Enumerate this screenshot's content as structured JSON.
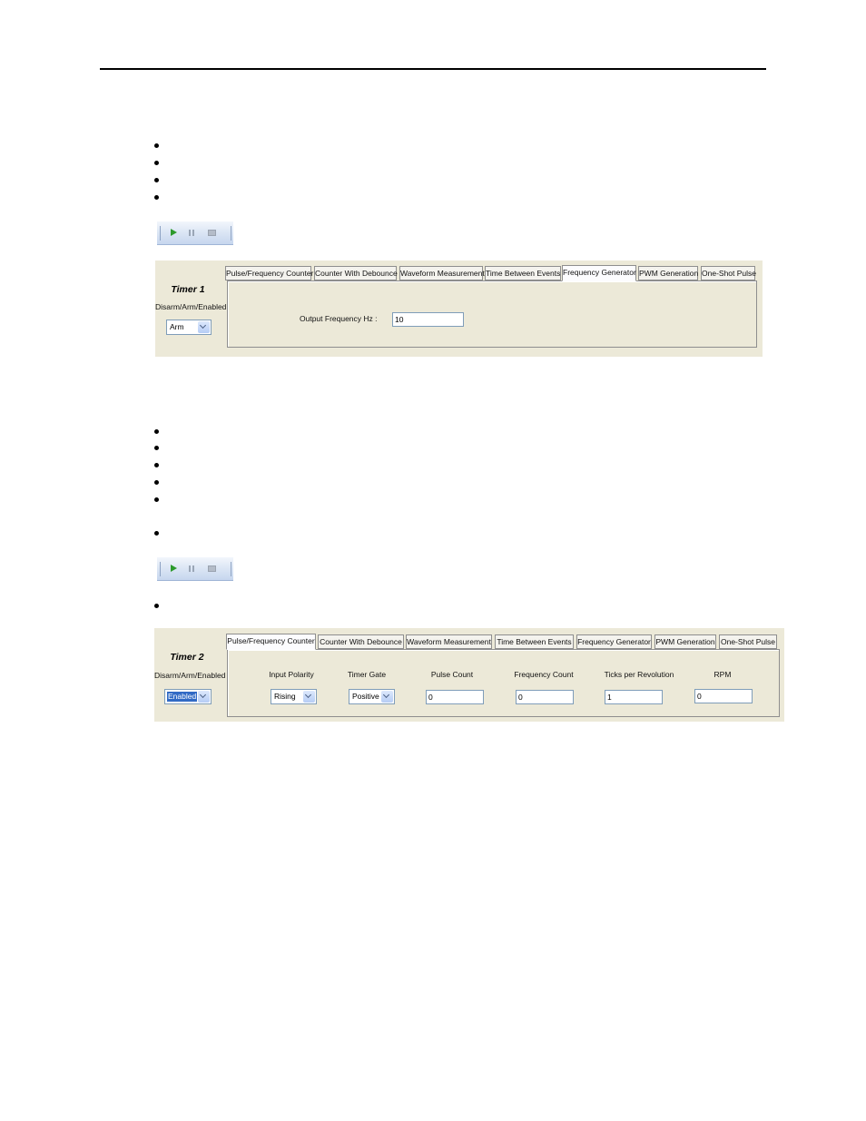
{
  "toolbar_icons": [
    "play-icon",
    "pause-icon",
    "stop-icon"
  ],
  "tabs": [
    "Pulse/Frequency Counter",
    "Counter With Debounce",
    "Waveform Measurement",
    "Time Between Events",
    "Frequency Generator",
    "PWM Generation",
    "One-Shot Pulse"
  ],
  "timer1": {
    "title": "Timer 1",
    "mode_label": "Disarm/Arm/Enabled",
    "mode_value": "Arm",
    "active_tab": "Frequency Generator",
    "output_frequency_label": "Output Frequency Hz :",
    "output_frequency_value": "10"
  },
  "timer2": {
    "title": "Timer 2",
    "mode_label": "Disarm/Arm/Enabled",
    "mode_value": "Enabled",
    "active_tab": "Pulse/Frequency Counter",
    "input_polarity_label": "Input Polarity",
    "input_polarity_value": "Rising",
    "timer_gate_label": "Timer Gate",
    "timer_gate_value": "Positive",
    "pulse_count_label": "Pulse Count",
    "pulse_count_value": "0",
    "frequency_count_label": "Frequency Count",
    "frequency_count_value": "0",
    "ticks_label": "Ticks per Revolution",
    "ticks_value": "1",
    "rpm_label": "RPM",
    "rpm_value": "0"
  },
  "colors": {
    "panel_bg": "#ece9d8",
    "play_green": "#2c9a2c",
    "selection_blue": "#316ac5"
  }
}
